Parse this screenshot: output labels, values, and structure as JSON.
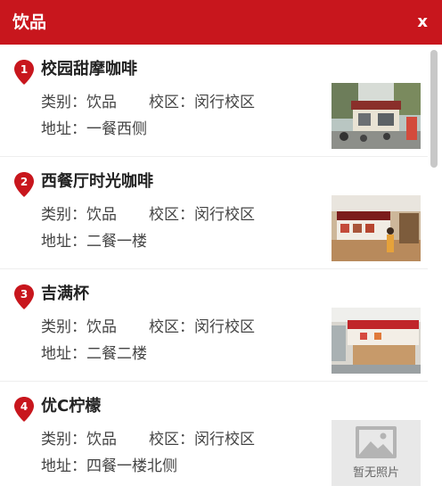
{
  "header": {
    "title": "饮品",
    "close_label": "x"
  },
  "items": [
    {
      "index": "1",
      "name": "校园甜摩咖啡",
      "category": "类别：饮品",
      "campus": "校区：闵行校区",
      "address": "地址：一餐西侧",
      "photo": "storefront"
    },
    {
      "index": "2",
      "name": "西餐厅时光咖啡",
      "category": "类别：饮品",
      "campus": "校区：闵行校区",
      "address": "地址：二餐一楼",
      "photo": "cafe-counter"
    },
    {
      "index": "3",
      "name": "吉满杯",
      "category": "类别：饮品",
      "campus": "校区：闵行校区",
      "address": "地址：二餐二楼",
      "photo": "kiosk"
    },
    {
      "index": "4",
      "name": "优C柠檬",
      "category": "类别：饮品",
      "campus": "校区：闵行校区",
      "address": "地址：四餐一楼北侧",
      "photo_placeholder": "暂无照片"
    }
  ],
  "colors": {
    "accent": "#c8161d"
  },
  "icons": {
    "pin": "map-pin-icon",
    "placeholder": "image-placeholder-icon"
  }
}
